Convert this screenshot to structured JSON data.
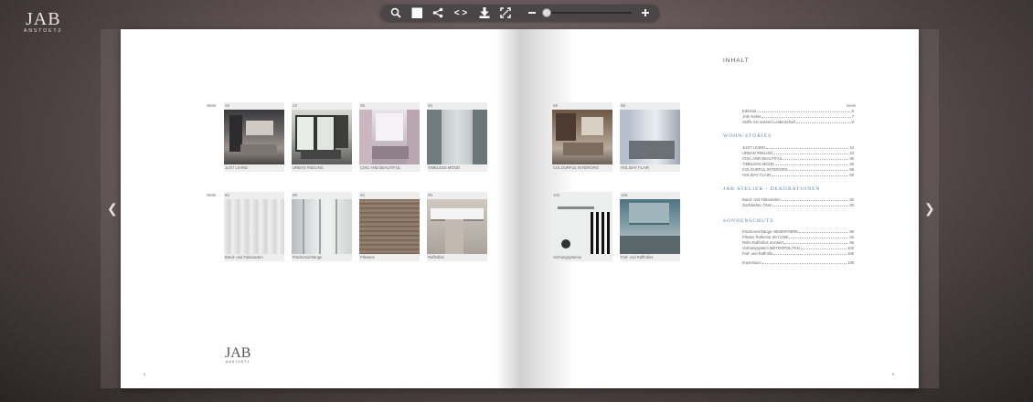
{
  "logo": {
    "main": "JAB",
    "sub": "ANSTOETZ"
  },
  "toolbar": {
    "icons": [
      "search-icon",
      "grid-icon",
      "share-icon",
      "embed-icon",
      "download-icon",
      "fullscreen-icon",
      "zoom-out-icon",
      "zoom-in-icon"
    ],
    "embed_glyph": "< >",
    "zoom_level": 0
  },
  "left_page": {
    "row1_label": "Seite",
    "row2_label": "Seite",
    "row1": [
      {
        "page": "10",
        "caption": "JUST LIVING"
      },
      {
        "page": "22",
        "caption": "URBAN FEELING"
      },
      {
        "page": "36",
        "caption": "CHIC AND BEAUTIFUL"
      },
      {
        "page": "46",
        "caption": "TIMELESS MOOD"
      }
    ],
    "row2": [
      {
        "page": "82",
        "caption": "Band- und Faltenarten"
      },
      {
        "page": "88",
        "caption": "Flächenvorhänge"
      },
      {
        "page": "92",
        "caption": "Plissees"
      },
      {
        "page": "96",
        "caption": "Raffrollos"
      }
    ],
    "page_number": "4",
    "logo_main": "JAB",
    "logo_sub": "ANSTOETZ"
  },
  "right_page": {
    "row1": [
      {
        "page": "58",
        "caption": "COLOURFUL INTERIORS"
      },
      {
        "page": "68",
        "caption": "HOLIDAY FLAIR"
      }
    ],
    "row2": [
      {
        "page": "102",
        "caption": "Vorhangsysteme"
      },
      {
        "page": "106",
        "caption": "Falt- und Raffrollos"
      }
    ],
    "page_number": "5"
  },
  "toc": {
    "title": "INHALT",
    "seite": "Seite",
    "intro": [
      {
        "label": "Editorial",
        "page": "5"
      },
      {
        "label": "JAB Atelier",
        "page": "7"
      },
      {
        "label": "Stoffe mit unserer Leidenschaft",
        "page": "8"
      }
    ],
    "section1": "WOHN-STORIES",
    "stories": [
      {
        "label": "JUST LIVING",
        "page": "10"
      },
      {
        "label": "URBAN FEELING",
        "page": "22"
      },
      {
        "label": "CHIC AND BEAUTIFUL",
        "page": "36"
      },
      {
        "label": "TIMELESS MOOD",
        "page": "46"
      },
      {
        "label": "COLOURFUL INTERIORS",
        "page": "58"
      },
      {
        "label": "HOLIDAY FLAIR",
        "page": "68"
      }
    ],
    "section2": "JAB ATELIER - DEKORATIONEN",
    "atelier": [
      {
        "label": "Band- und Faltenarten",
        "page": "82"
      },
      {
        "label": "Zierbänder, Ösen",
        "page": "83"
      }
    ],
    "section3": "SONNENSCHUTZ",
    "sun": [
      {
        "label": "Flächenvorhänge HEMISPHERE",
        "page": "88"
      },
      {
        "label": "Plissee Rollentor SKYLINE",
        "page": "92"
      },
      {
        "label": "Rollo-Raffrollos montiert",
        "page": "96"
      },
      {
        "label": "Vorhangsystem METROPOLITAN",
        "page": "102"
      },
      {
        "label": "Falt- und Raffrollo",
        "page": "106"
      }
    ],
    "imprint": {
      "label": "Impressum",
      "page": "108"
    }
  },
  "colors": {
    "accent": "#5a7ea6",
    "toolbar": "#4a4648"
  }
}
